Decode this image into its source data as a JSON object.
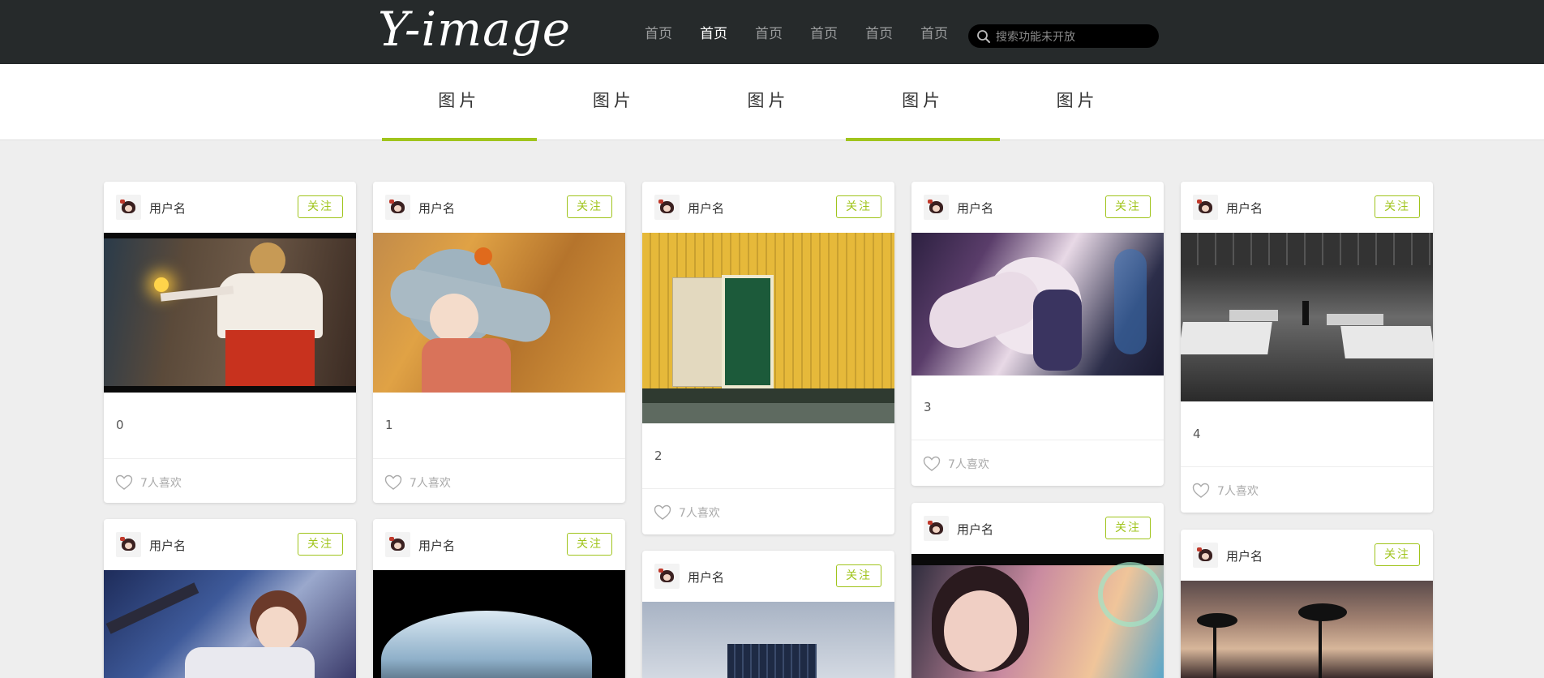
{
  "header": {
    "logo": "Y-image",
    "nav": [
      "首页",
      "首页",
      "首页",
      "首页",
      "首页",
      "首页"
    ],
    "active_nav_index": 1,
    "search_placeholder": "搜索功能未开放"
  },
  "tabs": {
    "items": [
      "图片",
      "图片",
      "图片",
      "图片",
      "图片"
    ],
    "active_indexes": [
      0,
      3
    ],
    "accent_color": "#a0c41c"
  },
  "cards": [
    {
      "username": "用户名",
      "follow": "关注",
      "caption": "0",
      "likes": "7人喜欢",
      "image": "anime girl with red ribbons"
    },
    {
      "username": "用户名",
      "follow": "关注",
      "caption": "1",
      "likes": "7人喜欢",
      "image": "anime girl autumn leaves"
    },
    {
      "username": "用户名",
      "follow": "关注",
      "caption": "2",
      "likes": "7人喜欢",
      "image": "yellow wall green door"
    },
    {
      "username": "用户名",
      "follow": "关注",
      "caption": "3",
      "likes": "7人喜欢",
      "image": "anime girl white dress"
    },
    {
      "username": "用户名",
      "follow": "关注",
      "caption": "4",
      "likes": "7人喜欢",
      "image": "pool hall black and white"
    },
    {
      "username": "用户名",
      "follow": "关注",
      "image": "anime girl night sky"
    },
    {
      "username": "用户名",
      "follow": "关注",
      "image": "snowy mountain dark"
    },
    {
      "username": "用户名",
      "follow": "关注",
      "image": "building sky"
    },
    {
      "username": "用户名",
      "follow": "关注",
      "image": "anime girl rainbow"
    },
    {
      "username": "用户名",
      "follow": "关注",
      "image": "palm trees sunset"
    }
  ],
  "colors": {
    "header_bg": "#262a2b",
    "accent": "#a0c41c",
    "page_bg": "#eeeeee"
  }
}
